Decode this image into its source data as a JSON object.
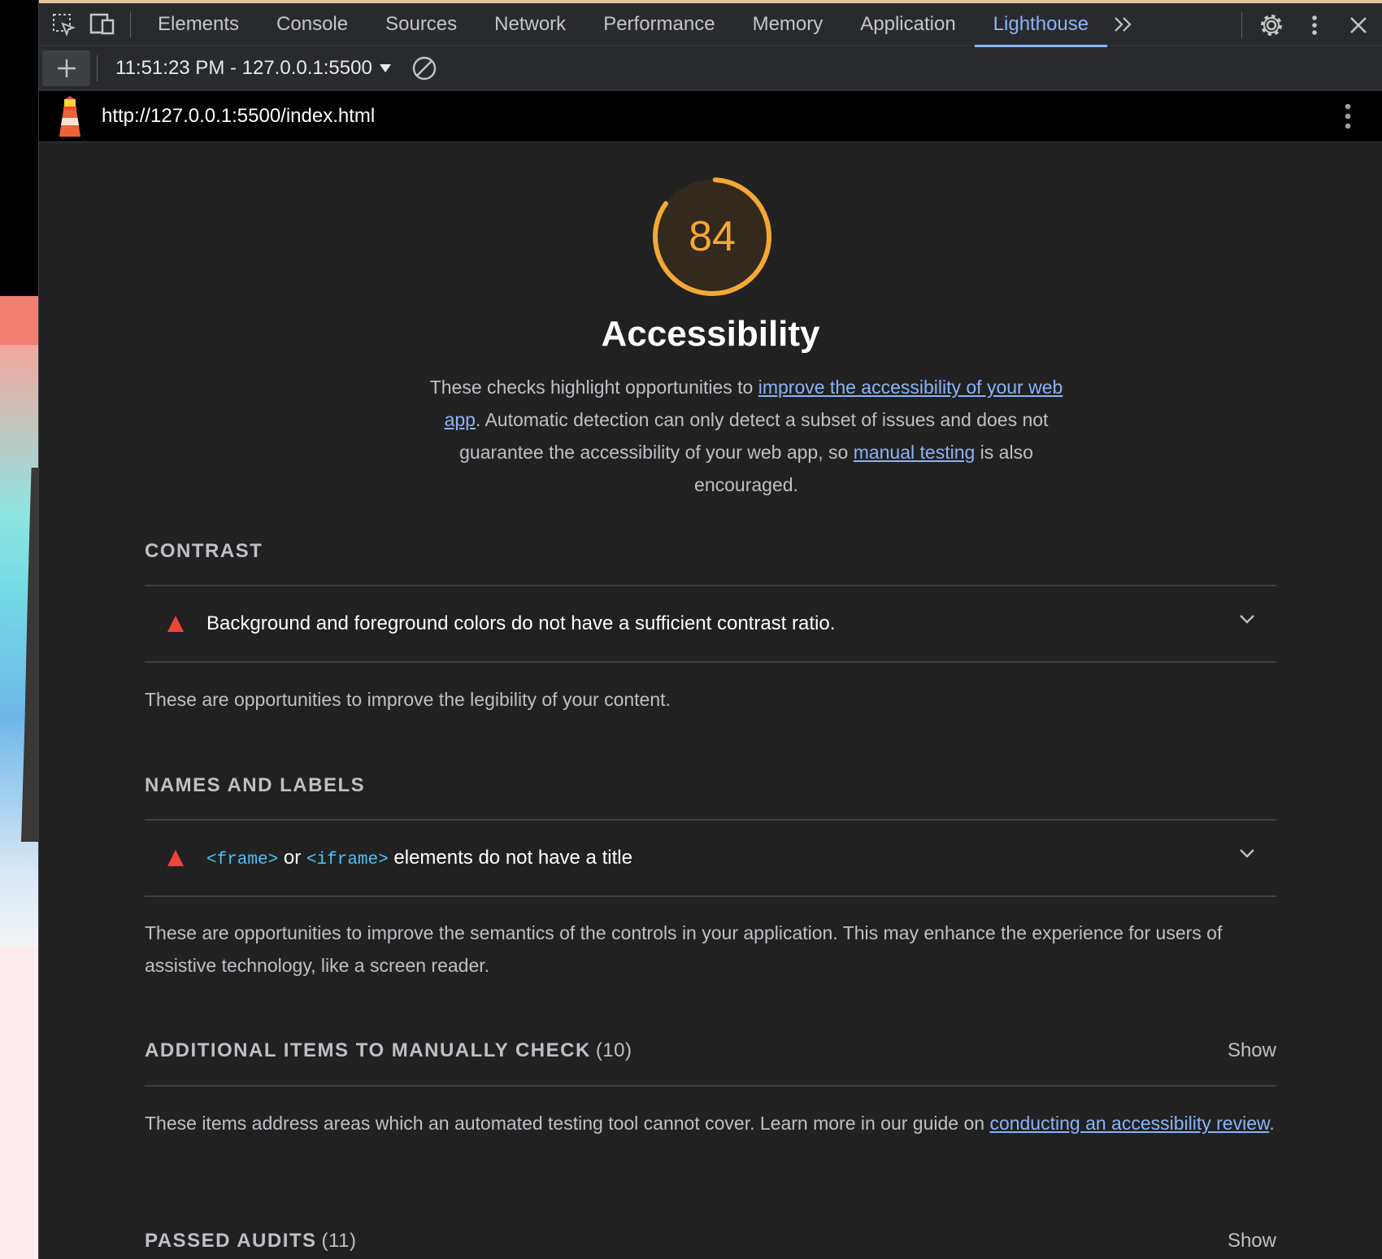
{
  "tabs": [
    {
      "label": "Elements"
    },
    {
      "label": "Console"
    },
    {
      "label": "Sources"
    },
    {
      "label": "Network"
    },
    {
      "label": "Performance"
    },
    {
      "label": "Memory"
    },
    {
      "label": "Application"
    },
    {
      "label": "Lighthouse",
      "active": true
    }
  ],
  "toolbar": {
    "report_label": "11:51:23 PM - 127.0.0.1:5500"
  },
  "urlbar": {
    "url": "http://127.0.0.1:5500/index.html"
  },
  "category": {
    "score": "84",
    "score_fraction": 0.84,
    "score_color": "#f4a835",
    "title": "Accessibility",
    "desc_part1": "These checks highlight opportunities to ",
    "desc_link1": "improve the accessibility of your web app",
    "desc_part2": ". Automatic detection can only detect a subset of issues and does not guarantee the accessibility of your web app, so ",
    "desc_link2": "manual testing",
    "desc_part3": " is also encouraged."
  },
  "groups": {
    "contrast": {
      "title": "CONTRAST",
      "audit": "Background and foreground colors do not have a sufficient contrast ratio.",
      "desc": "These are opportunities to improve the legibility of your content."
    },
    "names": {
      "title": "NAMES AND LABELS",
      "code1": "<frame>",
      "or": " or ",
      "code2": "<iframe>",
      "audit_rest": " elements do not have a title",
      "desc": "These are opportunities to improve the semantics of the controls in your application. This may enhance the experience for users of assistive technology, like a screen reader."
    },
    "manual": {
      "title": "ADDITIONAL ITEMS TO MANUALLY CHECK",
      "count": "(10)",
      "show": "Show",
      "desc_part1": "These items address areas which an automated testing tool cannot cover. Learn more in our guide on ",
      "desc_link": "conducting an accessibility review",
      "desc_part2": "."
    },
    "passed": {
      "title": "PASSED AUDITS",
      "count": "(11)",
      "show": "Show"
    }
  },
  "colors": {
    "fail": "#f44336",
    "link": "#8ab4f8",
    "accent": "#8ab4f8"
  }
}
